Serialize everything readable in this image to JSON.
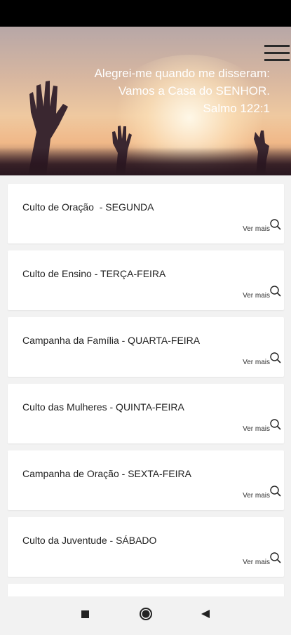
{
  "hero": {
    "verse_line1": "Alegrei-me quando me disseram:",
    "verse_line2": "Vamos a Casa do SENHOR.",
    "verse_ref": "Salmo 122:1"
  },
  "cards": [
    {
      "title": "Culto de Oração  - SEGUNDA",
      "more": "Ver mais"
    },
    {
      "title": "Culto de Ensino - TERÇA-FEIRA",
      "more": "Ver mais"
    },
    {
      "title": "Campanha da Família - QUARTA-FEIRA",
      "more": "Ver mais"
    },
    {
      "title": "Culto das Mulheres - QUINTA-FEIRA",
      "more": "Ver mais"
    },
    {
      "title": "Campanha de Oração - SEXTA-FEIRA",
      "more": "Ver mais"
    },
    {
      "title": "Culto da Juventude - SÁBADO",
      "more": "Ver mais"
    }
  ],
  "icons": {
    "menu": "hamburger-menu-icon",
    "more": "magnifier-icon",
    "nav": [
      "square-recents-icon",
      "circle-home-icon",
      "triangle-back-icon"
    ]
  }
}
